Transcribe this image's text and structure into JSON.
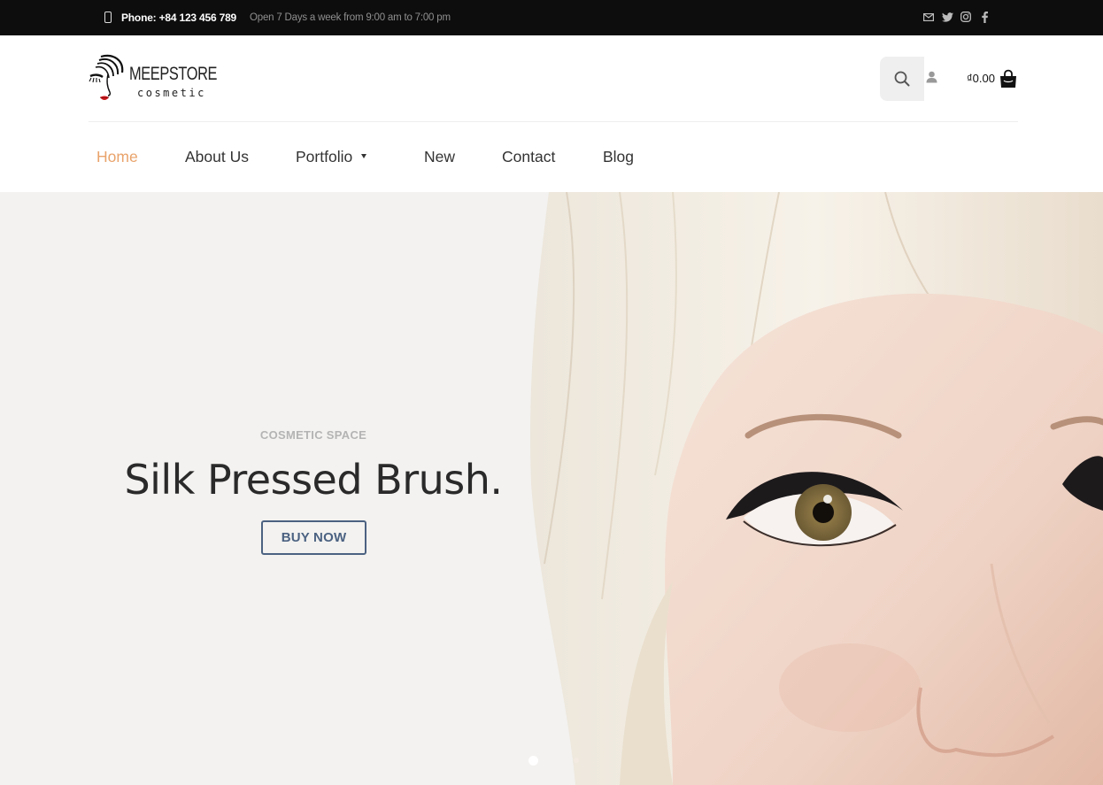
{
  "topbar": {
    "phone": "Phone: +84 123 456 789",
    "hours": "Open 7 Days a week from 9:00 am to 7:00 pm",
    "social_icons": [
      "mail-icon",
      "twitter-icon",
      "instagram-icon",
      "facebook-icon"
    ]
  },
  "logo": {
    "name": "MEEPSTORE",
    "tagline": "cosmetic"
  },
  "header": {
    "cart_amount": "₫0.00",
    "icons": [
      "search-icon",
      "user-icon",
      "shopping-bag-icon"
    ]
  },
  "nav": {
    "items": [
      {
        "label": "Home",
        "active": true
      },
      {
        "label": "About Us"
      },
      {
        "label": "Portfolio",
        "has_dropdown": true
      },
      {
        "label": "New"
      },
      {
        "label": "Contact"
      },
      {
        "label": "Blog"
      }
    ]
  },
  "hero": {
    "kicker": "COSMETIC SPACE",
    "title": "Silk Pressed Brush.",
    "button_label": "BUY NOW",
    "slides": 2,
    "active_slide": 1
  },
  "colors": {
    "topbar_bg": "#0d0d0d",
    "nav_active": "#e9a36b",
    "button_accent": "#4b6281",
    "hero_bg": "#f3f2f0"
  }
}
